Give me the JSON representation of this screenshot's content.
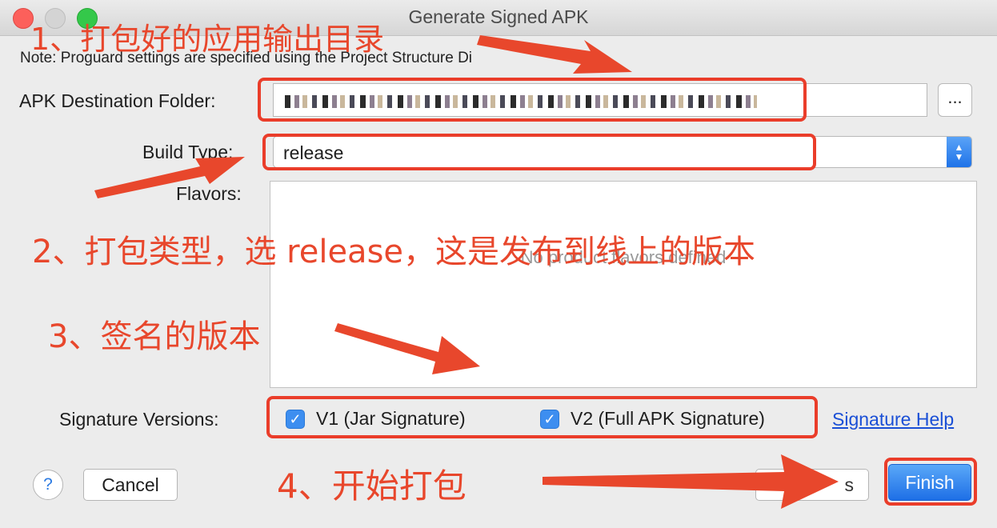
{
  "window": {
    "title": "Generate Signed APK"
  },
  "note": "Note: Proguard settings are specified using the Project Structure Di",
  "fields": {
    "destination_label": "APK Destination Folder:",
    "browse_label": "...",
    "build_type_label": "Build Type:",
    "build_type_value": "release",
    "flavors_label": "Flavors:",
    "flavors_empty": "No product flavors defined",
    "signature_label": "Signature Versions:"
  },
  "signature": {
    "v1_label": "V1 (Jar Signature)",
    "v1_checked": true,
    "v2_label": "V2 (Full APK Signature)",
    "v2_checked": true,
    "help_link": "Signature Help"
  },
  "buttons": {
    "help": "?",
    "cancel": "Cancel",
    "previous": "s",
    "finish": "Finish"
  },
  "annotations": {
    "step1": "1、打包好的应用输出目录",
    "step2": "2、打包类型，选 release，这是发布到线上的版本",
    "step3": "3、签名的版本",
    "step4": "4、开始打包"
  },
  "colors": {
    "annotation": "#e8472c",
    "accent": "#1f73e8",
    "link": "#1a4fd6"
  }
}
